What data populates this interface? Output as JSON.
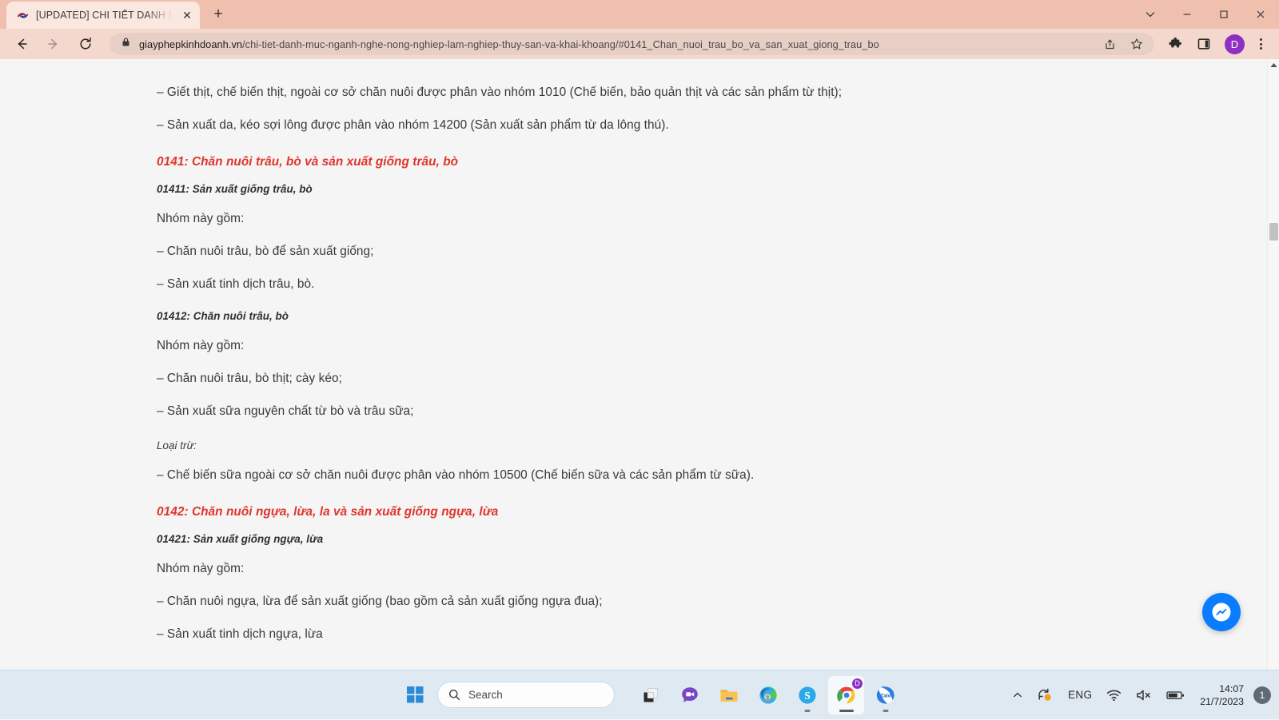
{
  "browser": {
    "tab": {
      "title": "[UPDATED] CHI TIẾT DANH MỤC",
      "favicon_name": "site-favicon",
      "close_label": "✕"
    },
    "new_tab_label": "+",
    "window_controls": {
      "chevron_label": "⌄",
      "minimize_label": "—",
      "maximize_label": "▢",
      "close_label": "✕"
    },
    "toolbar": {
      "back_label": "←",
      "forward_label": "→",
      "reload_label": "⟳",
      "url_host": "giayphepkinhdoanh.vn",
      "url_path": "/chi-tiet-danh-muc-nganh-nghe-nong-nghiep-lam-nghiep-thuy-san-va-khai-khoang/#0141_Chan_nuoi_trau_bo_va_san_xuat_giong_trau_bo",
      "share_icon": "share-icon",
      "bookmark_icon": "star-icon",
      "extensions_icon": "puzzle-icon",
      "side_panel_icon": "side-panel-icon",
      "profile_initial": "D",
      "menu_icon": "three-dot-menu-icon"
    }
  },
  "page": {
    "blocks": [
      {
        "type": "para",
        "text": "– Giết thịt, chế biến thịt, ngoài cơ sở chăn nuôi được phân vào nhóm 1010 (Chế biến, bảo quản thịt và các sản phẩm từ thịt);"
      },
      {
        "type": "para",
        "text": "– Sản xuất da, kéo sợi lông được phân vào nhóm 14200 (Sản xuất sản phẩm từ da lông thú)."
      },
      {
        "type": "heading-red",
        "text": "0141: Chăn nuôi trâu, bò và sản xuất giống trâu, bò"
      },
      {
        "type": "code-italic",
        "text": "01411: Sản xuất giống trâu, bò"
      },
      {
        "type": "para",
        "text": "Nhóm này gồm:"
      },
      {
        "type": "para",
        "text": "– Chăn nuôi trâu, bò để sản xuất giống;"
      },
      {
        "type": "para",
        "text": "– Sản xuất tinh dịch trâu, bò."
      },
      {
        "type": "code-italic",
        "text": "01412: Chăn nuôi trâu, bò"
      },
      {
        "type": "para",
        "text": "Nhóm này gồm:"
      },
      {
        "type": "para",
        "text": "– Chăn nuôi trâu, bò thịt; cày kéo;"
      },
      {
        "type": "para",
        "text": "– Sản xuất sữa nguyên chất từ bò và trâu sữa;"
      },
      {
        "type": "note-italic",
        "text": "Loại trừ:"
      },
      {
        "type": "para",
        "text": "– Chế biến sữa ngoài cơ sở chăn nuôi được phân vào nhóm 10500 (Chế biến sữa và các sản phẩm từ sữa)."
      },
      {
        "type": "heading-red",
        "text": "0142: Chăn nuôi ngựa, lừa, la và sản xuất giống ngựa, lừa"
      },
      {
        "type": "code-italic",
        "text": "01421: Sản xuất giống ngựa, lừa"
      },
      {
        "type": "para",
        "text": "Nhóm này gồm:"
      },
      {
        "type": "para",
        "text": "– Chăn nuôi ngựa, lừa để sản xuất giống (bao gồm cả sản xuất giống ngựa đua);"
      },
      {
        "type": "para",
        "text": "– Sản xuất tinh dịch ngựa, lừa"
      }
    ],
    "messenger_bubble_name": "messenger-chat-icon",
    "colors": {
      "heading_red": "#e0352b",
      "body_text": "#36393b",
      "page_background": "#f5f5f5",
      "browser_chrome": "#f0c0ae"
    }
  },
  "taskbar": {
    "start_name": "windows-start-icon",
    "search_placeholder": "Search",
    "apps": [
      {
        "name": "taskbar-app-file-explorer-dark",
        "icon": "stacked-squares-icon"
      },
      {
        "name": "taskbar-app-chat",
        "icon": "chat-bubble-icon"
      },
      {
        "name": "taskbar-app-file-explorer",
        "icon": "folder-icon"
      },
      {
        "name": "taskbar-app-edge",
        "icon": "edge-icon"
      },
      {
        "name": "taskbar-app-skype",
        "icon": "skype-icon"
      },
      {
        "name": "taskbar-app-chrome",
        "icon": "chrome-icon"
      },
      {
        "name": "taskbar-app-zalo",
        "icon": "zalo-icon"
      }
    ],
    "tray": {
      "overflow_label": "⌃",
      "sync_icon": "onedrive-sync-icon",
      "language": "ENG",
      "wifi_icon": "wifi-icon",
      "volume_icon": "volume-muted-icon",
      "battery_icon": "battery-icon",
      "time": "14:07",
      "date": "21/7/2023",
      "notification_count": "1"
    }
  }
}
